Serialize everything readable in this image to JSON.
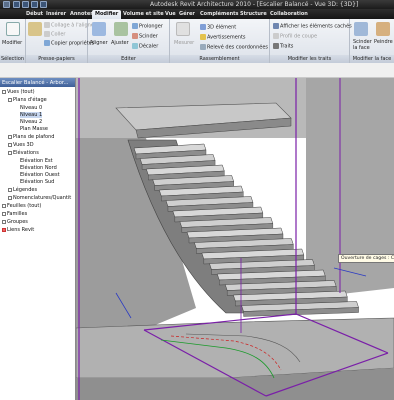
{
  "title_bar": {
    "title": "Autodesk Revit Architecture 2010 - [Escalier Balancé - Vue 3D: {3D}]"
  },
  "tabs": [
    {
      "label": "Début"
    },
    {
      "label": "Insérer"
    },
    {
      "label": "Annoter"
    },
    {
      "label": "Modifier"
    },
    {
      "label": "Volume et site"
    },
    {
      "label": "Vue"
    },
    {
      "label": "Gérer"
    },
    {
      "label": "Compléments"
    },
    {
      "label": "Structure"
    },
    {
      "label": "Collaboration"
    }
  ],
  "ribbon": {
    "selection": {
      "button": "Modifier",
      "title": "Sélection"
    },
    "presse_papiers": {
      "coller_aligne": "Collage à l'aligné",
      "coller": "Coller",
      "copier_proprietes": "Copier propriétés",
      "title": "Presse-papiers"
    },
    "editer": {
      "aligner": "Aligner",
      "ajuster": "Ajuster",
      "prolonger": "Prolonger",
      "scinder": "Scinder",
      "decaler": "Décaler",
      "title": "Editer"
    },
    "rassemblement": {
      "mesurer": "Mesurer",
      "element_3d": "3D élément",
      "avertissements": "Avertissements",
      "releve": "Relevé des coordonnées",
      "title": "Rassemblement"
    },
    "modifier_traits": {
      "afficher": "Afficher les éléments cachés",
      "profil_coupe": "Profil de coupe",
      "traits": "Traits",
      "title": "Modifier les traits"
    },
    "modifier_face": {
      "scinder_face": "Scinder la face",
      "peindre": "Peindre",
      "title": "Modifier la face"
    }
  },
  "browser": {
    "header": "Escalier Balancé - Arbor...",
    "items": [
      {
        "label": "Vues (tout)"
      },
      {
        "label": "Plans d'étage"
      },
      {
        "label": "Niveau 0"
      },
      {
        "label": "Niveau 1"
      },
      {
        "label": "Niveau 2"
      },
      {
        "label": "Plan Masse"
      },
      {
        "label": "Plans de plafond"
      },
      {
        "label": "Vues 3D"
      },
      {
        "label": "Elévations"
      },
      {
        "label": "Elévation Est"
      },
      {
        "label": "Elévation Nord"
      },
      {
        "label": "Elévation Ouest"
      },
      {
        "label": "Elévation Sud"
      },
      {
        "label": "Légendes"
      },
      {
        "label": "Nomenclatures/Quantit"
      },
      {
        "label": "Feuilles (tout)"
      },
      {
        "label": "Familles"
      },
      {
        "label": "Groupes"
      },
      {
        "label": "Liens Revit"
      }
    ]
  },
  "viewport": {
    "tooltip": "Ouverture de cages : Coupe de l'ouverture",
    "steps": [
      0,
      1,
      2,
      3,
      4,
      5,
      6,
      7,
      8,
      9,
      10,
      11,
      12,
      13,
      14,
      15
    ]
  },
  "colors": {
    "accent": "#3e5f98",
    "section_box": "#7a1fa8",
    "tab_bar": "#1f1f1f"
  }
}
